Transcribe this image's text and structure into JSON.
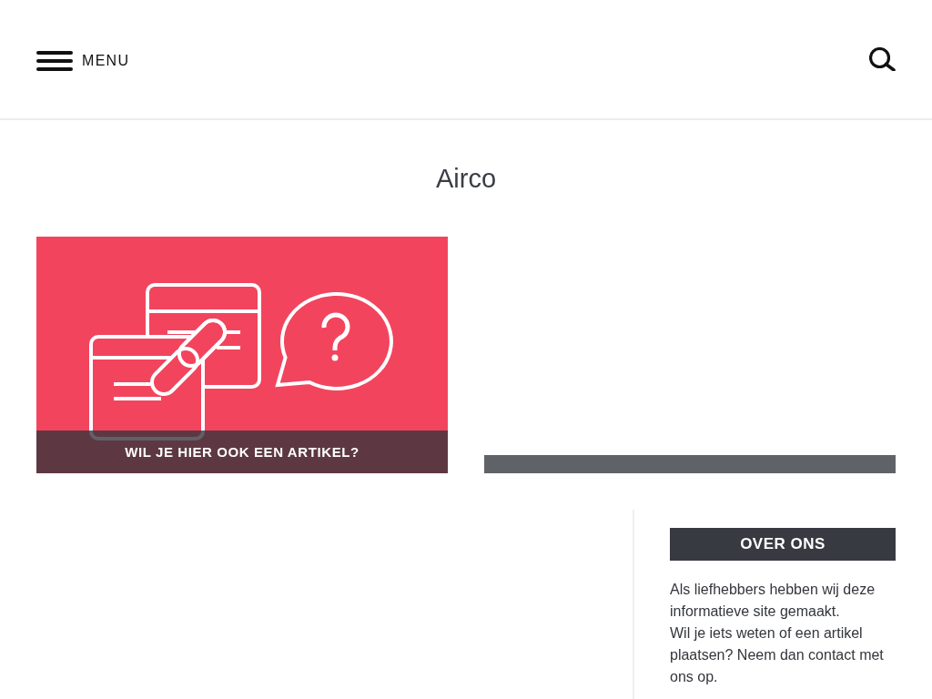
{
  "header": {
    "menu_label": "MENU"
  },
  "page": {
    "title": "Airco"
  },
  "posts": [
    {
      "kind": "illustration",
      "caption": "WIL JE HIER OOK EEN ARTIKEL?"
    },
    {
      "kind": "blank"
    }
  ],
  "sidebar": {
    "widgets": [
      {
        "title": "OVER ONS",
        "lines": [
          "Als liefhebbers hebben wij deze informatieve site gemaakt.",
          "Wil je iets weten of een artikel plaatsen? Neem dan contact met ons op."
        ]
      }
    ]
  }
}
